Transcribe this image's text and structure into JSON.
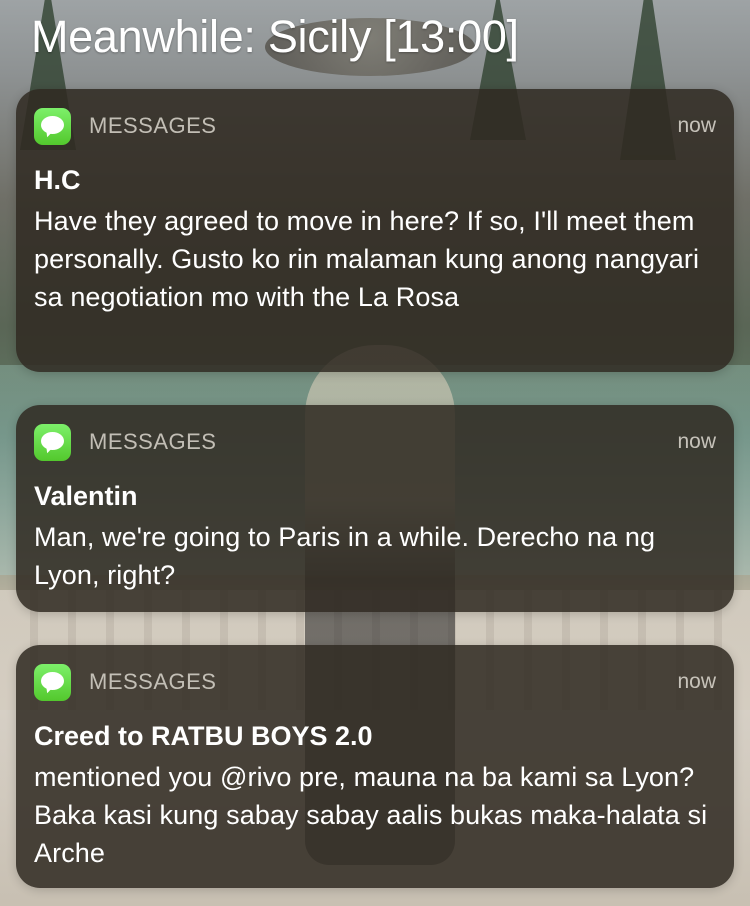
{
  "header": {
    "title": "Meanwhile: Sicily [13:00]"
  },
  "notifications": [
    {
      "app_name": "MESSAGES",
      "time": "now",
      "sender": "H.C",
      "message": "Have they agreed to move in here? If so, I'll meet them personally. Gusto ko rin malaman kung anong nangyari sa negotiation mo with the La Rosa",
      "icon": "messages-icon"
    },
    {
      "app_name": "MESSAGES",
      "time": "now",
      "sender": "Valentin",
      "message": "Man, we're going to Paris in a while. Derecho na ng Lyon, right?",
      "icon": "messages-icon"
    },
    {
      "app_name": "MESSAGES",
      "time": "now",
      "sender": "Creed to RATBU BOYS 2.0",
      "message": "mentioned you @rivo pre, mauna na ba kami sa Lyon? Baka kasi kung sabay sabay aalis bukas maka-halata si Arche",
      "icon": "messages-icon"
    }
  ],
  "colors": {
    "card_background": "#302a22",
    "messages_icon_green": "#53c82d",
    "text_primary": "#ffffff",
    "text_secondary": "#d5d1c8"
  }
}
